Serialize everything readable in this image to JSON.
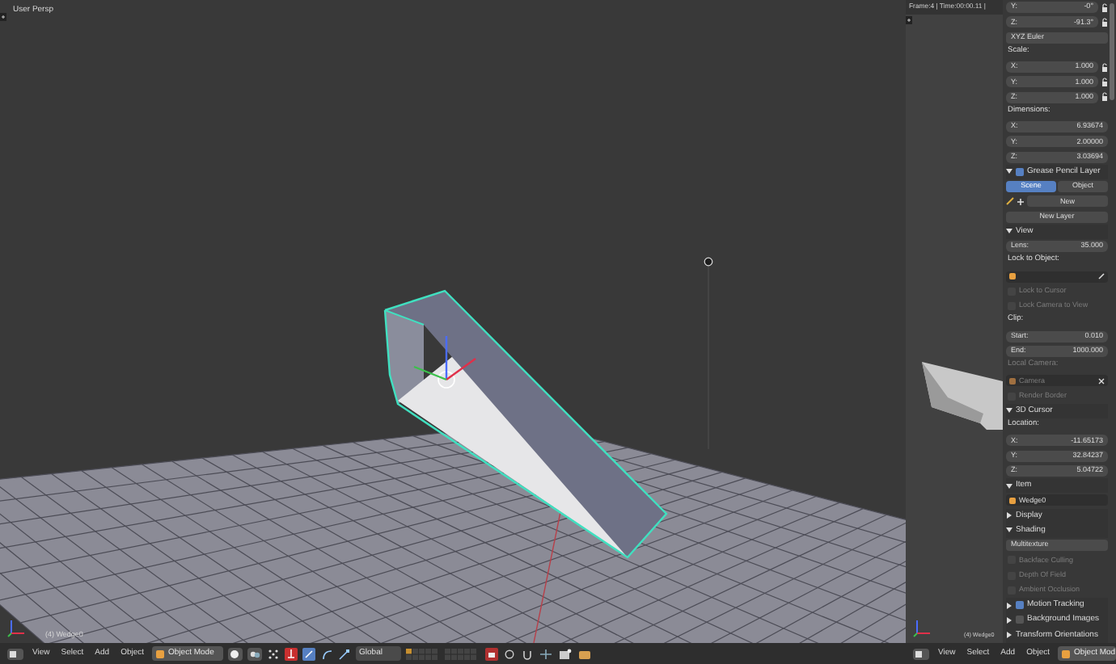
{
  "main_viewport": {
    "view_label": "User Persp",
    "object_label": "(4) Wedge0"
  },
  "main_header": {
    "menus": [
      "View",
      "Select",
      "Add",
      "Object"
    ],
    "mode": "Object Mode",
    "orientation": "Global"
  },
  "side_viewport": {
    "info": "Frame:4 | Time:00:00.11 |",
    "object_label": "(4) Wedge0"
  },
  "side_header": {
    "menus": [
      "View",
      "Select",
      "Add",
      "Object"
    ],
    "mode": "Object Mod"
  },
  "properties": {
    "rows": [
      {
        "kind": "field",
        "label": "Y:",
        "value": "-0°",
        "locked": true
      },
      {
        "kind": "field",
        "label": "Z:",
        "value": "-91.3°",
        "locked": true
      },
      {
        "kind": "dropdown",
        "value": "XYZ Euler"
      },
      {
        "kind": "label",
        "label": "Scale:",
        "disabled": false
      },
      {
        "kind": "field",
        "label": "X:",
        "value": "1.000",
        "locked": true
      },
      {
        "kind": "field",
        "label": "Y:",
        "value": "1.000",
        "locked": true
      },
      {
        "kind": "field",
        "label": "Z:",
        "value": "1.000",
        "locked": true
      },
      {
        "kind": "label",
        "label": "Dimensions:",
        "disabled": false
      },
      {
        "kind": "field",
        "label": "X:",
        "value": "6.93674",
        "locked": false
      },
      {
        "kind": "field",
        "label": "Y:",
        "value": "2.00000",
        "locked": false
      },
      {
        "kind": "field",
        "label": "Z:",
        "value": "3.03694",
        "locked": false
      },
      {
        "kind": "header",
        "label": "Grease Pencil Layer",
        "expanded": true,
        "checked": true
      },
      {
        "kind": "tabs",
        "items": [
          {
            "label": "Scene",
            "selected": true
          },
          {
            "label": "Object",
            "selected": false
          }
        ]
      },
      {
        "kind": "datablock",
        "label": "New"
      },
      {
        "kind": "button",
        "label": "New Layer"
      },
      {
        "kind": "header",
        "label": "View",
        "expanded": true
      },
      {
        "kind": "field",
        "label": "Lens:",
        "value": "35.000",
        "locked": false
      },
      {
        "kind": "label",
        "label": "Lock to Object:",
        "disabled": false
      },
      {
        "kind": "object_field",
        "eyedropper": true,
        "disabled": false
      },
      {
        "kind": "checkbox",
        "label": "Lock to Cursor",
        "checked": false,
        "disabled": true
      },
      {
        "kind": "checkbox",
        "label": "Lock Camera to View",
        "checked": false,
        "disabled": true
      },
      {
        "kind": "label",
        "label": "Clip:",
        "disabled": false
      },
      {
        "kind": "field",
        "label": "Start:",
        "value": "0.010",
        "locked": false
      },
      {
        "kind": "field",
        "label": "End:",
        "value": "1000.000",
        "locked": false
      },
      {
        "kind": "label",
        "label": "Local Camera:",
        "disabled": true
      },
      {
        "kind": "object_field",
        "value": "Camera",
        "clear_button": true,
        "disabled": true
      },
      {
        "kind": "checkbox",
        "label": "Render Border",
        "checked": false,
        "disabled": true
      },
      {
        "kind": "header",
        "label": "3D Cursor",
        "expanded": true
      },
      {
        "kind": "label",
        "label": "Location:",
        "disabled": false
      },
      {
        "kind": "field",
        "label": "X:",
        "value": "-11.65173",
        "locked": false
      },
      {
        "kind": "field",
        "label": "Y:",
        "value": "32.84237",
        "locked": false
      },
      {
        "kind": "field",
        "label": "Z:",
        "value": "5.04722",
        "locked": false
      },
      {
        "kind": "header",
        "label": "Item",
        "expanded": true
      },
      {
        "kind": "object_field",
        "value": "Wedge0",
        "disabled": false
      },
      {
        "kind": "header",
        "label": "Display",
        "expanded": false
      },
      {
        "kind": "header",
        "label": "Shading",
        "expanded": true
      },
      {
        "kind": "dropdown",
        "value": "Multitexture"
      },
      {
        "kind": "checkbox",
        "label": "Backface Culling",
        "checked": false,
        "disabled": true
      },
      {
        "kind": "checkbox",
        "label": "Depth Of Field",
        "checked": false,
        "disabled": true
      },
      {
        "kind": "checkbox",
        "label": "Ambient Occlusion",
        "checked": false,
        "disabled": true
      },
      {
        "kind": "header",
        "label": "Motion Tracking",
        "expanded": false,
        "checked": true
      },
      {
        "kind": "header",
        "label": "Background Images",
        "expanded": false,
        "checked": false
      },
      {
        "kind": "header",
        "label": "Transform Orientations",
        "expanded": false
      }
    ]
  }
}
